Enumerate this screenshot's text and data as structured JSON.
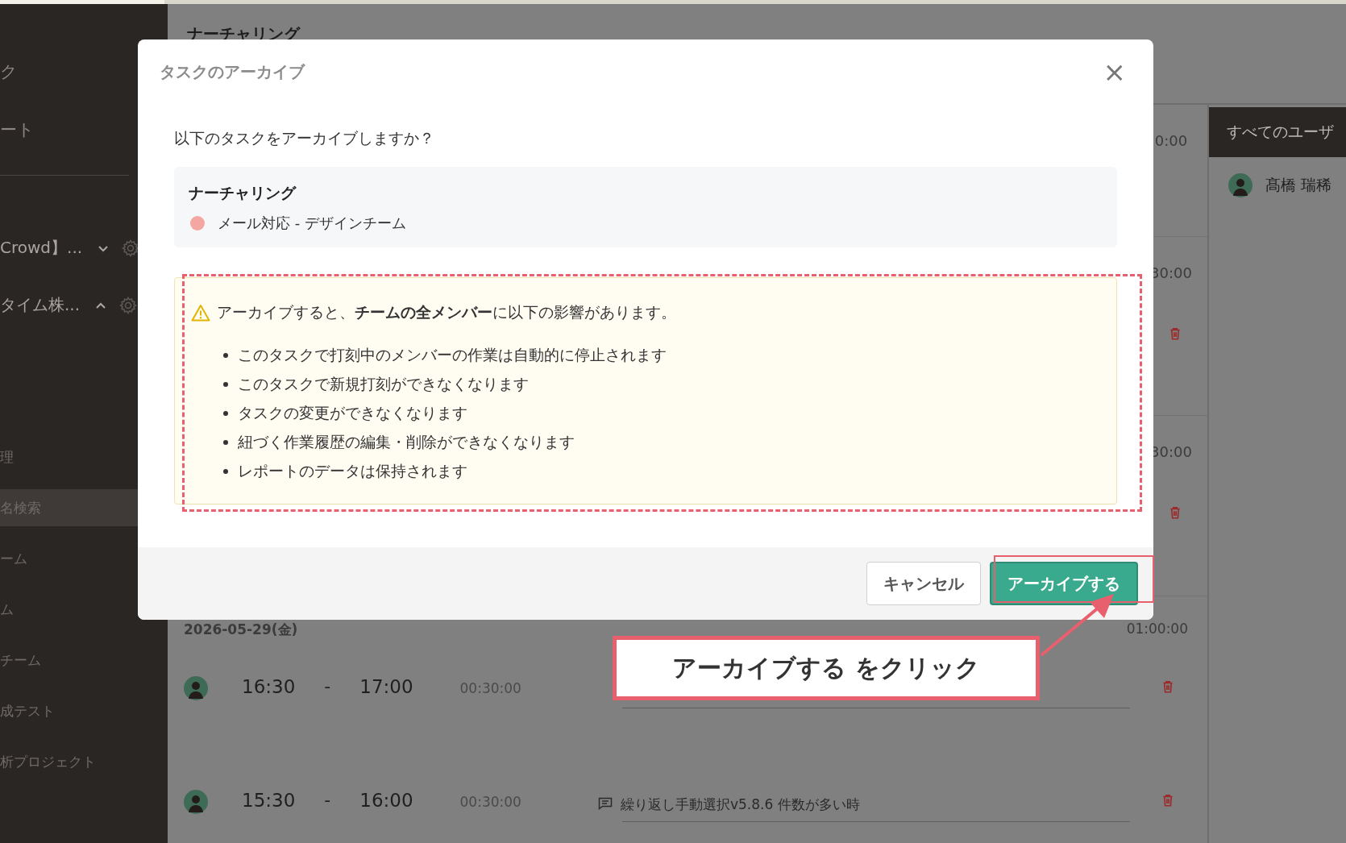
{
  "sidebar": {
    "nav": [
      {
        "label": "ク",
        "selected": false
      },
      {
        "label": "ート",
        "selected": false
      }
    ],
    "projects": [
      {
        "name": "Crowd】...",
        "expanded": false
      },
      {
        "name": "タイム株...",
        "expanded": true,
        "children": [
          {
            "label": "理",
            "selected": false
          },
          {
            "label": "名検索",
            "selected": true
          },
          {
            "label": "ーム",
            "selected": false
          },
          {
            "label": "ム",
            "selected": false
          },
          {
            "label": "チーム",
            "selected": false
          },
          {
            "label": "成テスト",
            "selected": false
          },
          {
            "label": "析プロジェクト",
            "selected": false
          }
        ]
      }
    ]
  },
  "header": {
    "title": "ナーチャリング"
  },
  "timeline": {
    "blocks": [
      {
        "total": "0:00",
        "deletable": false
      },
      {
        "total": "30:00",
        "deletable": true
      },
      {
        "total": "30:00",
        "deletable": true
      }
    ],
    "day": {
      "date": "2026-05-29(金)",
      "total": "01:00:00",
      "entries": [
        {
          "start": "16:30",
          "separator": "-",
          "end": "17:00",
          "duration": "00:30:00"
        },
        {
          "start": "15:30",
          "separator": "-",
          "end": "16:00",
          "duration": "00:30:00",
          "comment": "繰り返し手動選択v5.8.6 件数が多い時"
        }
      ]
    }
  },
  "user_panel": {
    "title": "すべてのユーザ",
    "users": [
      "髙橋 瑞稀"
    ]
  },
  "dialog": {
    "title": "タスクのアーカイブ",
    "close": "×",
    "question": "以下のタスクをアーカイブしますか？",
    "task": {
      "name": "ナーチャリング",
      "project": "メール対応 - デザインチーム",
      "color": "#f4a6a0"
    },
    "warning": {
      "lead": "アーカイブすると、**チームの全メンバー**に以下の影響があります。",
      "points": [
        "このタスクで打刻中のメンバーの作業は自動的に停止されます",
        "このタスクで新規打刻ができなくなります",
        "タスクの変更ができなくなります",
        "紐づく作業履歴の編集・削除ができなくなります",
        "レポートのデータは保持されます"
      ]
    },
    "buttons": [
      {
        "label": "キャンセル",
        "kind": "secondary"
      },
      {
        "label": "アーカイブする",
        "kind": "primary"
      }
    ]
  },
  "annotation": {
    "callout": "アーカイブする をクリック"
  }
}
